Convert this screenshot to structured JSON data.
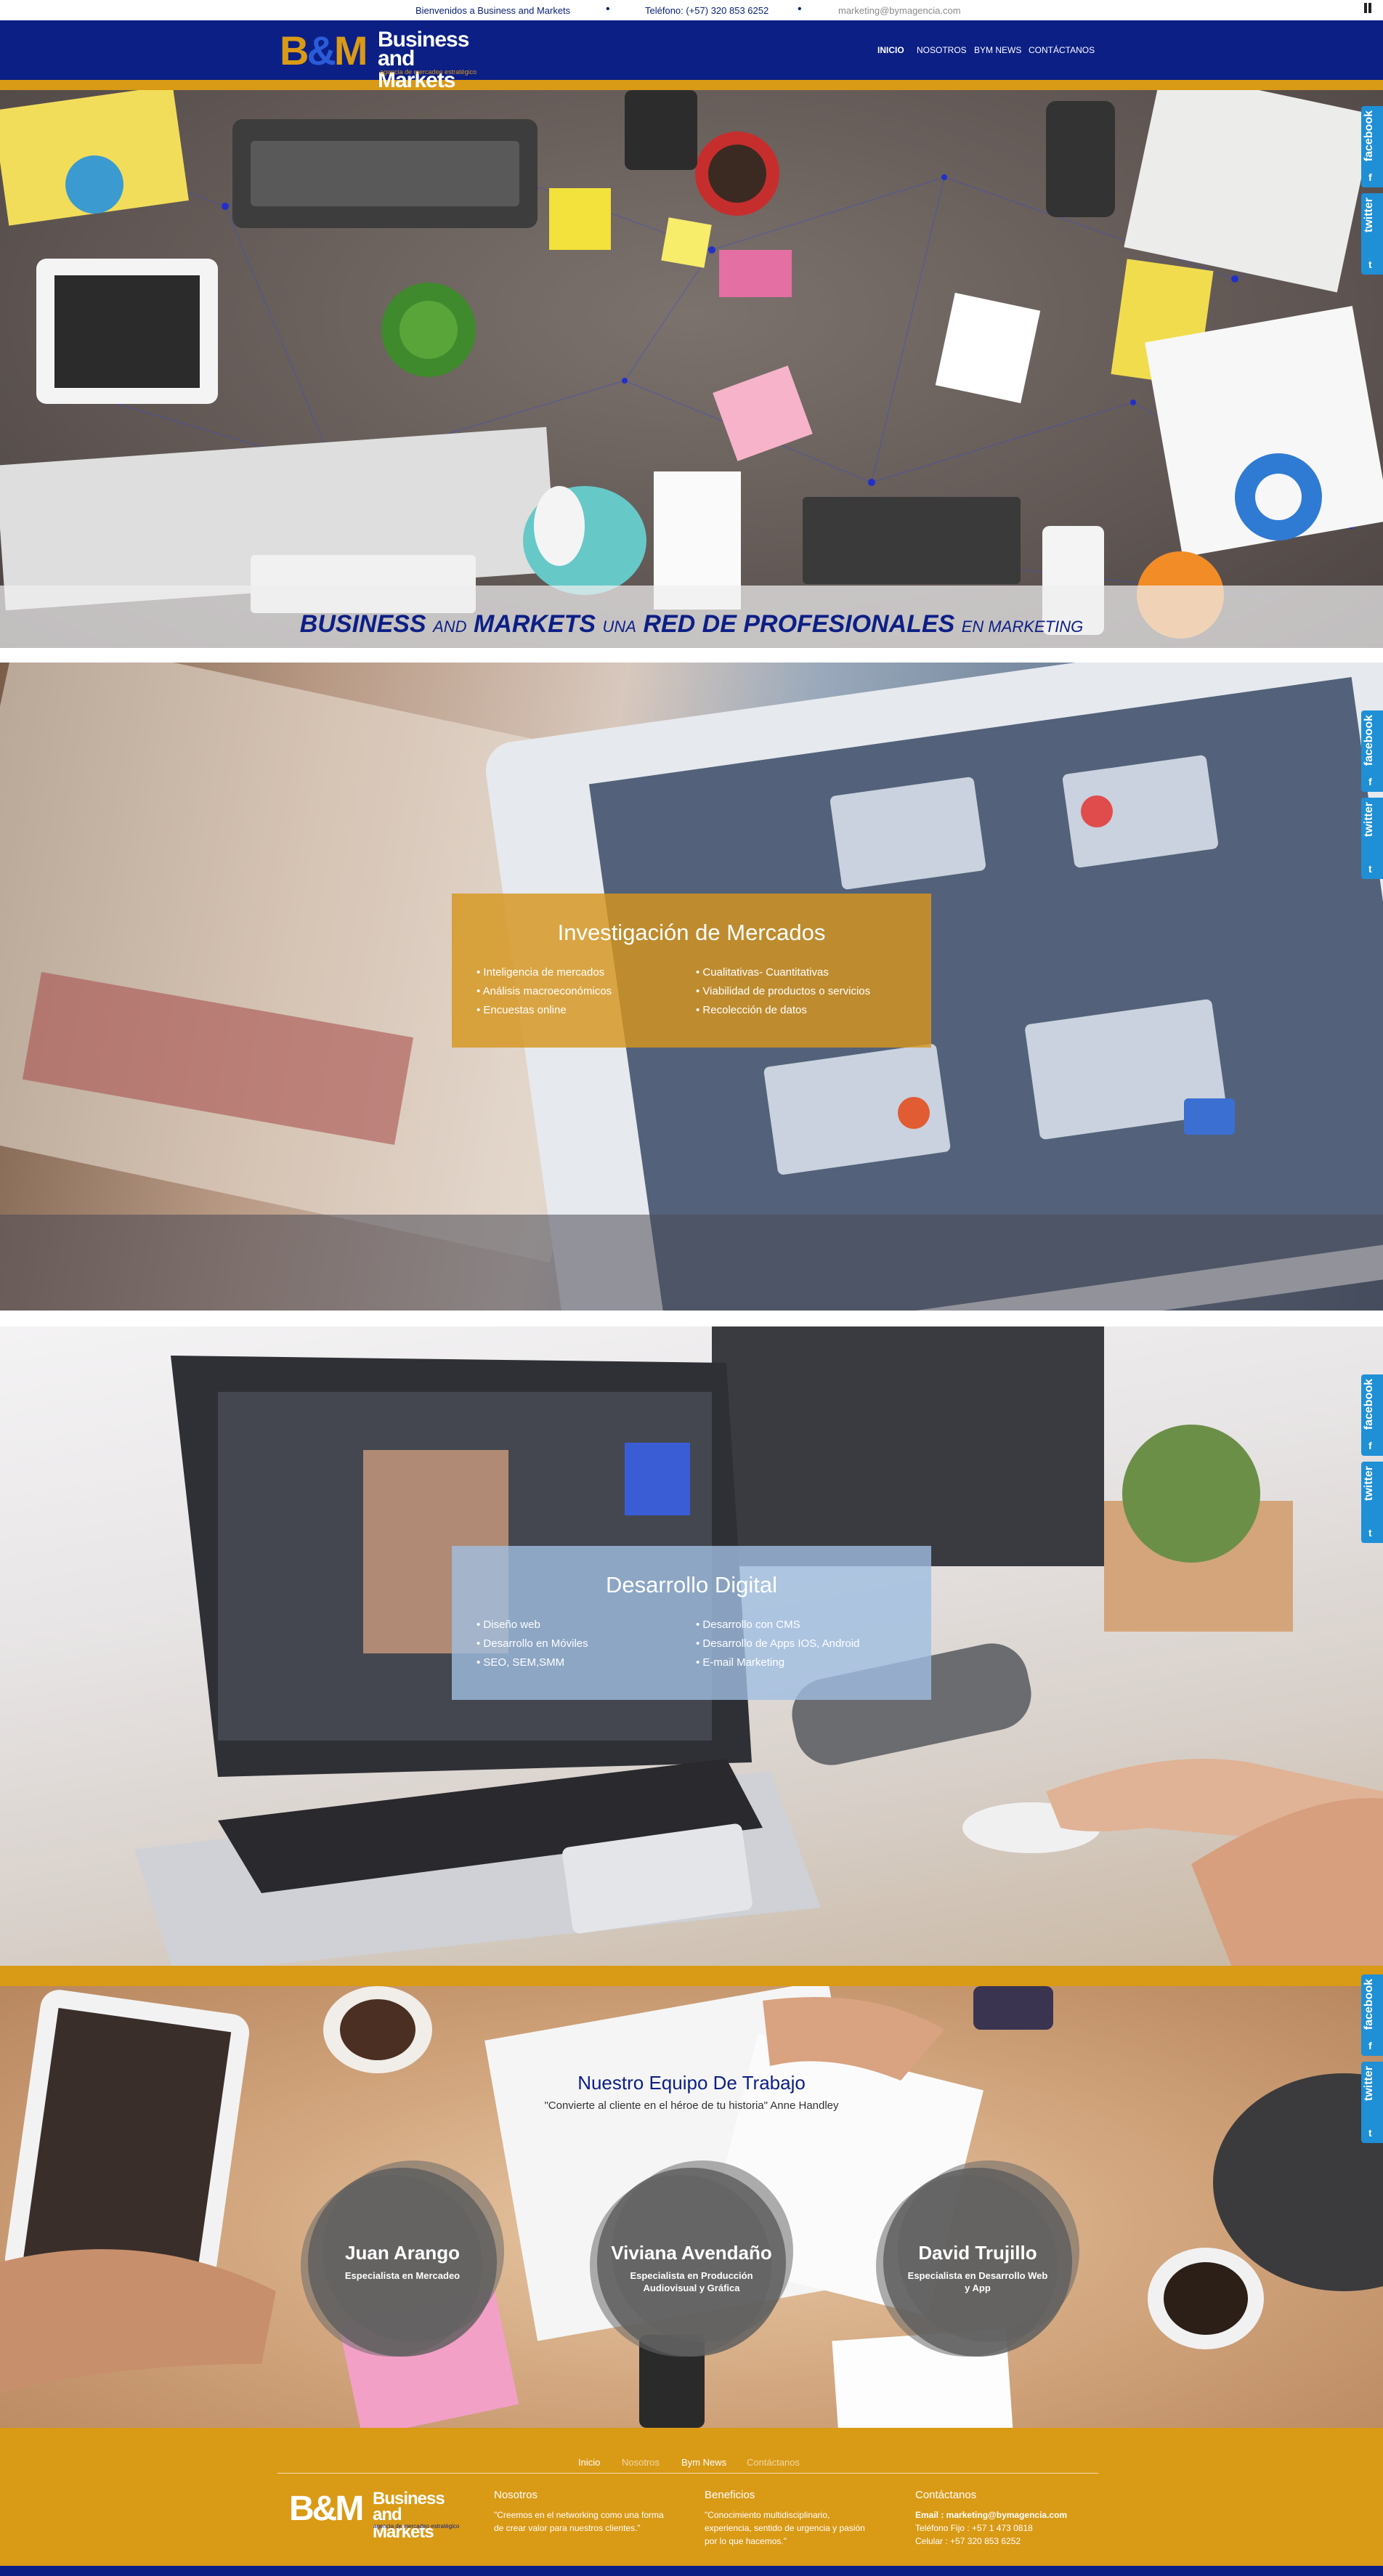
{
  "topbar": {
    "welcome": "Bienvenidos a Business and Markets",
    "phone": "Teléfono: (+57) 320 853 6252",
    "email": "marketing@bymagencia.com"
  },
  "brand": {
    "logo_mark": "B&M",
    "name_line1": "Business",
    "name_line2": "and Markets",
    "tagline": "agencia de mercadeo estratégico"
  },
  "nav": [
    "Inicio",
    "Nosotros",
    "BYM News",
    "Contáctanos"
  ],
  "hero": {
    "t1": "BUSINESS",
    "t2": "AND",
    "t3": "MARKETS",
    "t4": "UNA",
    "t5": "RED DE PROFESIONALES",
    "t6": "EN MARKETING"
  },
  "service1": {
    "title_a": "Investigación",
    "title_b": "de Mercados",
    "left": [
      "Inteligencia de mercados",
      "Análisis macroeconómicos",
      "Encuestas online"
    ],
    "right": [
      "Cualitativas- Cuantitativas",
      "Viabilidad de productos o servicios",
      "Recolección de datos"
    ]
  },
  "service2": {
    "title_a": "Desarrollo",
    "title_b": "Digital",
    "left": [
      "Diseño web",
      "Desarrollo en Móviles",
      "SEO, SEM,SMM"
    ],
    "right": [
      "Desarrollo con CMS",
      "Desarrollo de Apps IOS, Android",
      "E-mail Marketing"
    ]
  },
  "team": {
    "title": "Nuestro Equipo De Trabajo",
    "quote": "\"Convierte al cliente en el héroe de tu historia\" Anne Handley",
    "members": [
      {
        "name": "Juan Arango",
        "role": "Especialista en Mercadeo"
      },
      {
        "name": "Viviana Avendaño",
        "role": "Especialista en Producción Audiovisual y Gráfica"
      },
      {
        "name": "David Trujillo",
        "role": "Especialista en Desarrollo Web y App"
      }
    ]
  },
  "footer": {
    "nav": [
      "Inicio",
      "Nosotros",
      "Bym News",
      "Contáctanos"
    ],
    "nosotros_title": "Nosotros",
    "nosotros_text": "\"Creemos en el networking como una forma de crear valor para nuestros clientes.\"",
    "beneficios_title": "Beneficios",
    "beneficios_text": "\"Conocimiento multidisciplinario, experiencia, sentido de urgencia y pasión por lo que hacemos.\"",
    "contact_title": "Contáctanos",
    "contact_email": "Email : marketing@bymagencia.com",
    "contact_fijo": "Teléfono Fijo : +57 1 473 0818",
    "contact_celular": "Celular : +57 320 853 6252"
  },
  "social": {
    "facebook": "facebook",
    "facebook_icon": "f",
    "twitter": "twitter",
    "twitter_icon": "t"
  },
  "colors": {
    "navy": "#0c1f85",
    "gold": "#d99a16",
    "social_blue": "#1f8fd6"
  }
}
